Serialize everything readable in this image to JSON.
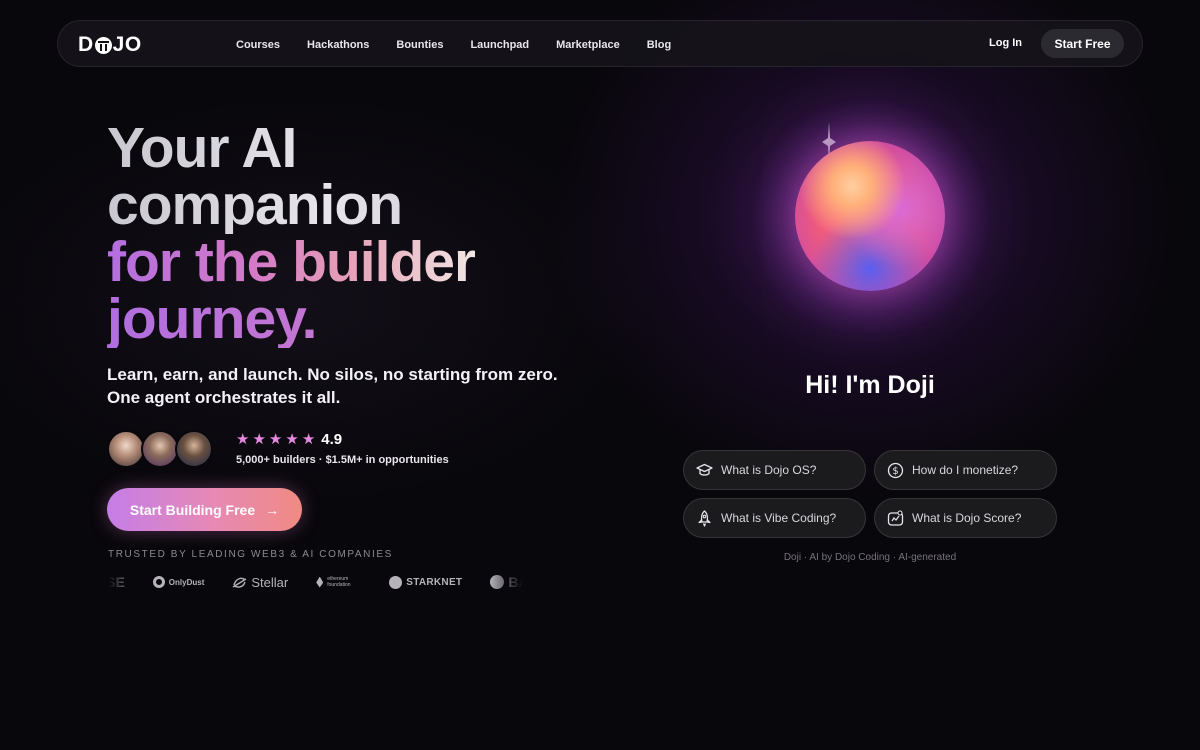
{
  "nav": {
    "logo": "DOJO",
    "links": [
      "Courses",
      "Hackathons",
      "Bounties",
      "Launchpad",
      "Marketplace",
      "Blog"
    ],
    "login": "Log In",
    "start_free": "Start Free"
  },
  "hero": {
    "headline": [
      "Your AI",
      "companion",
      "for the builder",
      "journey."
    ],
    "subtitle_lines": [
      "Learn, earn, and launch. No silos, no starting from zero.",
      "One agent orchestrates it all."
    ],
    "rating": "4.9",
    "star_count": 5,
    "stats": "5,000+ builders · $1.5M+ in opportunities",
    "cta": "Start Building Free",
    "trusted_label": "TRUSTED BY LEADING WEB3 & AI COMPANIES",
    "partners": [
      "ASE",
      "OnlyDust",
      "Stellar",
      "ethereum foundation",
      "STARKNET",
      "BASE"
    ]
  },
  "assistant": {
    "greeting": "Hi! I'm Doji",
    "suggestions": [
      {
        "icon": "graduation-cap-icon",
        "label": "What is Dojo OS?"
      },
      {
        "icon": "dollar-coin-icon",
        "label": "How do I monetize?"
      },
      {
        "icon": "rocket-icon",
        "label": "What is Vibe Coding?"
      },
      {
        "icon": "score-gauge-icon",
        "label": "What is Dojo Score?"
      }
    ],
    "credit": "Doji · AI by Dojo Coding · AI-generated"
  },
  "colors": {
    "background": "#08070b",
    "cta_gradient_start": "#c47ee8",
    "cta_gradient_end": "#f08a82",
    "star": "#e58ae0"
  }
}
